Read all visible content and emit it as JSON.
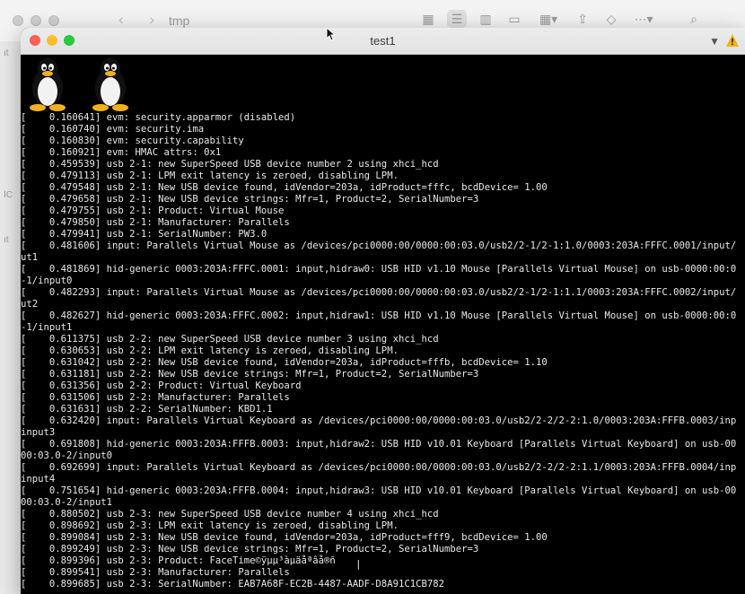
{
  "finder": {
    "title": "tmp",
    "sidebar_marks": [
      "ıt",
      "IC",
      "ıt"
    ]
  },
  "window": {
    "title": "test1"
  },
  "console_lines": [
    "[    0.160641] evm: security.apparmor (disabled)",
    "[    0.160740] evm: security.ima",
    "[    0.160830] evm: security.capability",
    "[    0.160921] evm: HMAC attrs: 0x1",
    "[    0.459539] usb 2-1: new SuperSpeed USB device number 2 using xhci_hcd",
    "[    0.479113] usb 2-1: LPM exit latency is zeroed, disabling LPM.",
    "[    0.479548] usb 2-1: New USB device found, idVendor=203a, idProduct=fffc, bcdDevice= 1.00",
    "[    0.479658] usb 2-1: New USB device strings: Mfr=1, Product=2, SerialNumber=3",
    "[    0.479755] usb 2-1: Product: Virtual Mouse",
    "[    0.479850] usb 2-1: Manufacturer: Parallels",
    "[    0.479941] usb 2-1: SerialNumber: PW3.0",
    "[    0.481606] input: Parallels Virtual Mouse as /devices/pci0000:00/0000:00:03.0/usb2/2-1/2-1:1.0/0003:203A:FFFC.0001/input/",
    "ut1",
    "[    0.481869] hid-generic 0003:203A:FFFC.0001: input,hidraw0: USB HID v1.10 Mouse [Parallels Virtual Mouse] on usb-0000:00:0",
    "-1/input0",
    "[    0.482293] input: Parallels Virtual Mouse as /devices/pci0000:00/0000:00:03.0/usb2/2-1/2-1:1.1/0003:203A:FFFC.0002/input/",
    "ut2",
    "[    0.482627] hid-generic 0003:203A:FFFC.0002: input,hidraw1: USB HID v1.10 Mouse [Parallels Virtual Mouse] on usb-0000:00:0",
    "-1/input1",
    "[    0.611375] usb 2-2: new SuperSpeed USB device number 3 using xhci_hcd",
    "[    0.630653] usb 2-2: LPM exit latency is zeroed, disabling LPM.",
    "[    0.631042] usb 2-2: New USB device found, idVendor=203a, idProduct=fffb, bcdDevice= 1.10",
    "[    0.631181] usb 2-2: New USB device strings: Mfr=1, Product=2, SerialNumber=3",
    "[    0.631356] usb 2-2: Product: Virtual Keyboard",
    "[    0.631506] usb 2-2: Manufacturer: Parallels",
    "[    0.631631] usb 2-2: SerialNumber: KBD1.1",
    "[    0.632420] input: Parallels Virtual Keyboard as /devices/pci0000:00/0000:00:03.0/usb2/2-2/2-2:1.0/0003:203A:FFFB.0003/inp",
    "input3",
    "[    0.691808] hid-generic 0003:203A:FFFB.0003: input,hidraw2: USB HID v10.01 Keyboard [Parallels Virtual Keyboard] on usb-00",
    "00:03.0-2/input0",
    "[    0.692699] input: Parallels Virtual Keyboard as /devices/pci0000:00/0000:00:03.0/usb2/2-2/2-2:1.1/0003:203A:FFFB.0004/inp",
    "input4",
    "[    0.751654] hid-generic 0003:203A:FFFB.0004: input,hidraw3: USB HID v10.01 Keyboard [Parallels Virtual Keyboard] on usb-00",
    "00:03.0-2/input1",
    "[    0.880502] usb 2-3: new SuperSpeed USB device number 4 using xhci_hcd",
    "[    0.898692] usb 2-3: LPM exit latency is zeroed, disabling LPM.",
    "[    0.899084] usb 2-3: New USB device found, idVendor=203a, idProduct=fff9, bcdDevice= 1.00",
    "[    0.899249] usb 2-3: New USB device strings: Mfr=1, Product=2, SerialNumber=3",
    "[    0.899396] usb 2-3: Product: FaceTime©ÿµµ³àµäåªâå®ñ",
    "[    0.899541] usb 2-3: Manufacturer: Parallels",
    "[    0.899685] usb 2-3: SerialNumber: EAB7A68F-EC2B-4487-AADF-D8A91C1CB782"
  ],
  "colors": {
    "terminal_bg": "#000000",
    "terminal_fg": "#e8e8e8",
    "close": "#fe5f57",
    "minimize": "#febc2e",
    "zoom": "#28c840"
  },
  "icons": [
    "tux-icon",
    "tux-icon"
  ]
}
